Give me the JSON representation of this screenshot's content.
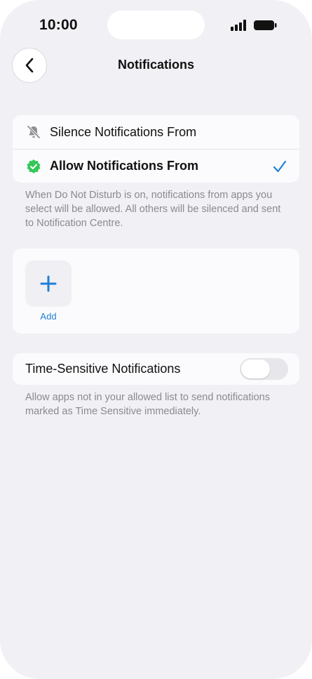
{
  "status_bar": {
    "time": "10:00"
  },
  "nav": {
    "title": "Notifications",
    "back_icon": "chevron-left-icon"
  },
  "mode_options": [
    {
      "label": "Silence Notifications From",
      "icon": "bell-slash-icon",
      "selected": false
    },
    {
      "label": "Allow Notifications From",
      "icon": "checkmark-seal-icon",
      "selected": true
    }
  ],
  "mode_description": "When Do Not Disturb is on, notifications from apps you select will be allowed. All others will be silenced and sent to Notification Centre.",
  "apps": {
    "add_label": "Add",
    "add_icon": "plus-icon"
  },
  "time_sensitive": {
    "label": "Time-Sensitive Notifications",
    "enabled": false,
    "description": "Allow apps not in your allowed list to send notifications marked as Time Sensitive immediately."
  },
  "colors": {
    "accent": "#1f7fd6",
    "allow_green": "#34c759",
    "background": "#f1f0f5"
  }
}
